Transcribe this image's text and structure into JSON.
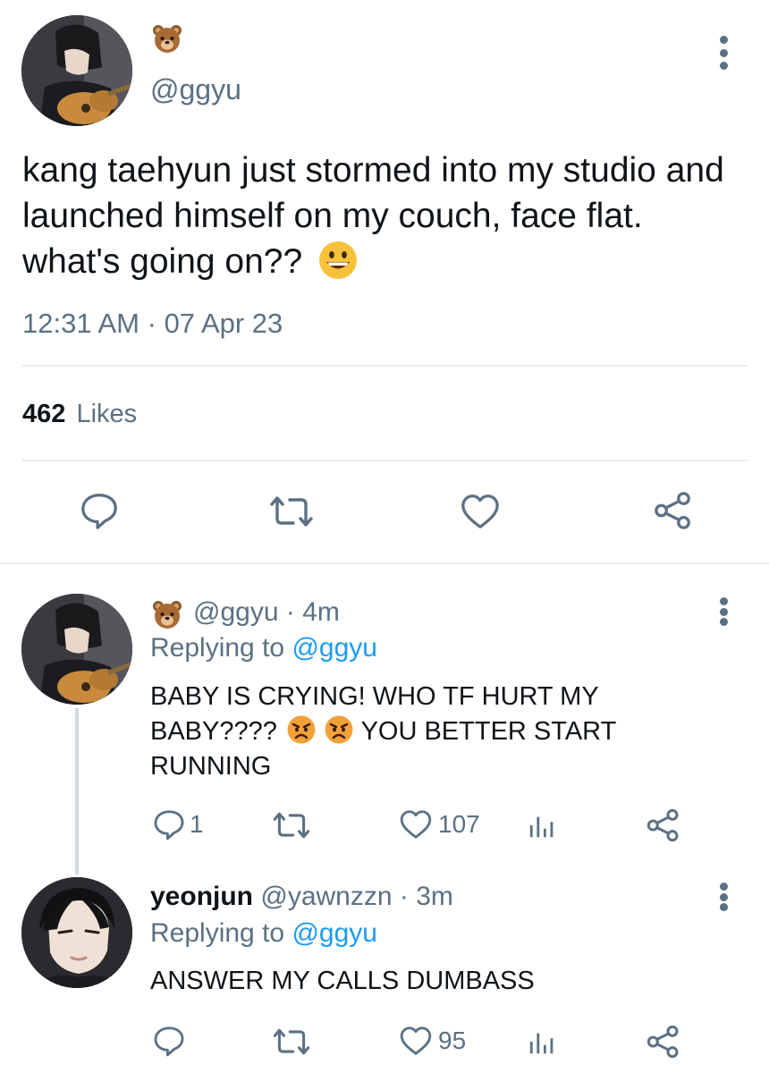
{
  "main_tweet": {
    "handle": "@ggyu",
    "avatar_icon": "guitar-player-avatar",
    "name_emoji": "bear-face-icon",
    "text": "kang taehyun just stormed into my studio and launched himself on my couch, face flat. what's going on??",
    "text_emoji": "grinning-face-icon",
    "time": "12:31 AM",
    "separator": "·",
    "date": "07 Apr 23",
    "likes_count": "462",
    "likes_label": "Likes"
  },
  "replies": [
    {
      "handle": "@ggyu",
      "separator": "·",
      "age": "4m",
      "replying_prefix": "Replying to",
      "replying_handle": "@ggyu",
      "text_part1": "BABY IS CRYING! WHO TF HURT MY BABY????",
      "text_emoji": "angry-face-icon",
      "text_part2": "YOU BETTER START RUNNING",
      "reply_count": "1",
      "like_count": "107"
    },
    {
      "name": "yeonjun",
      "handle": "@yawnzzn",
      "separator": "·",
      "age": "3m",
      "replying_prefix": "Replying to",
      "replying_handle": "@ggyu",
      "text": "ANSWER MY CALLS DUMBASS",
      "reply_count": "",
      "like_count": "95"
    }
  ],
  "colors": {
    "text": "#0f1419",
    "muted": "#5b7083",
    "link": "#1d9bf0",
    "divider": "#e6ecf0"
  }
}
